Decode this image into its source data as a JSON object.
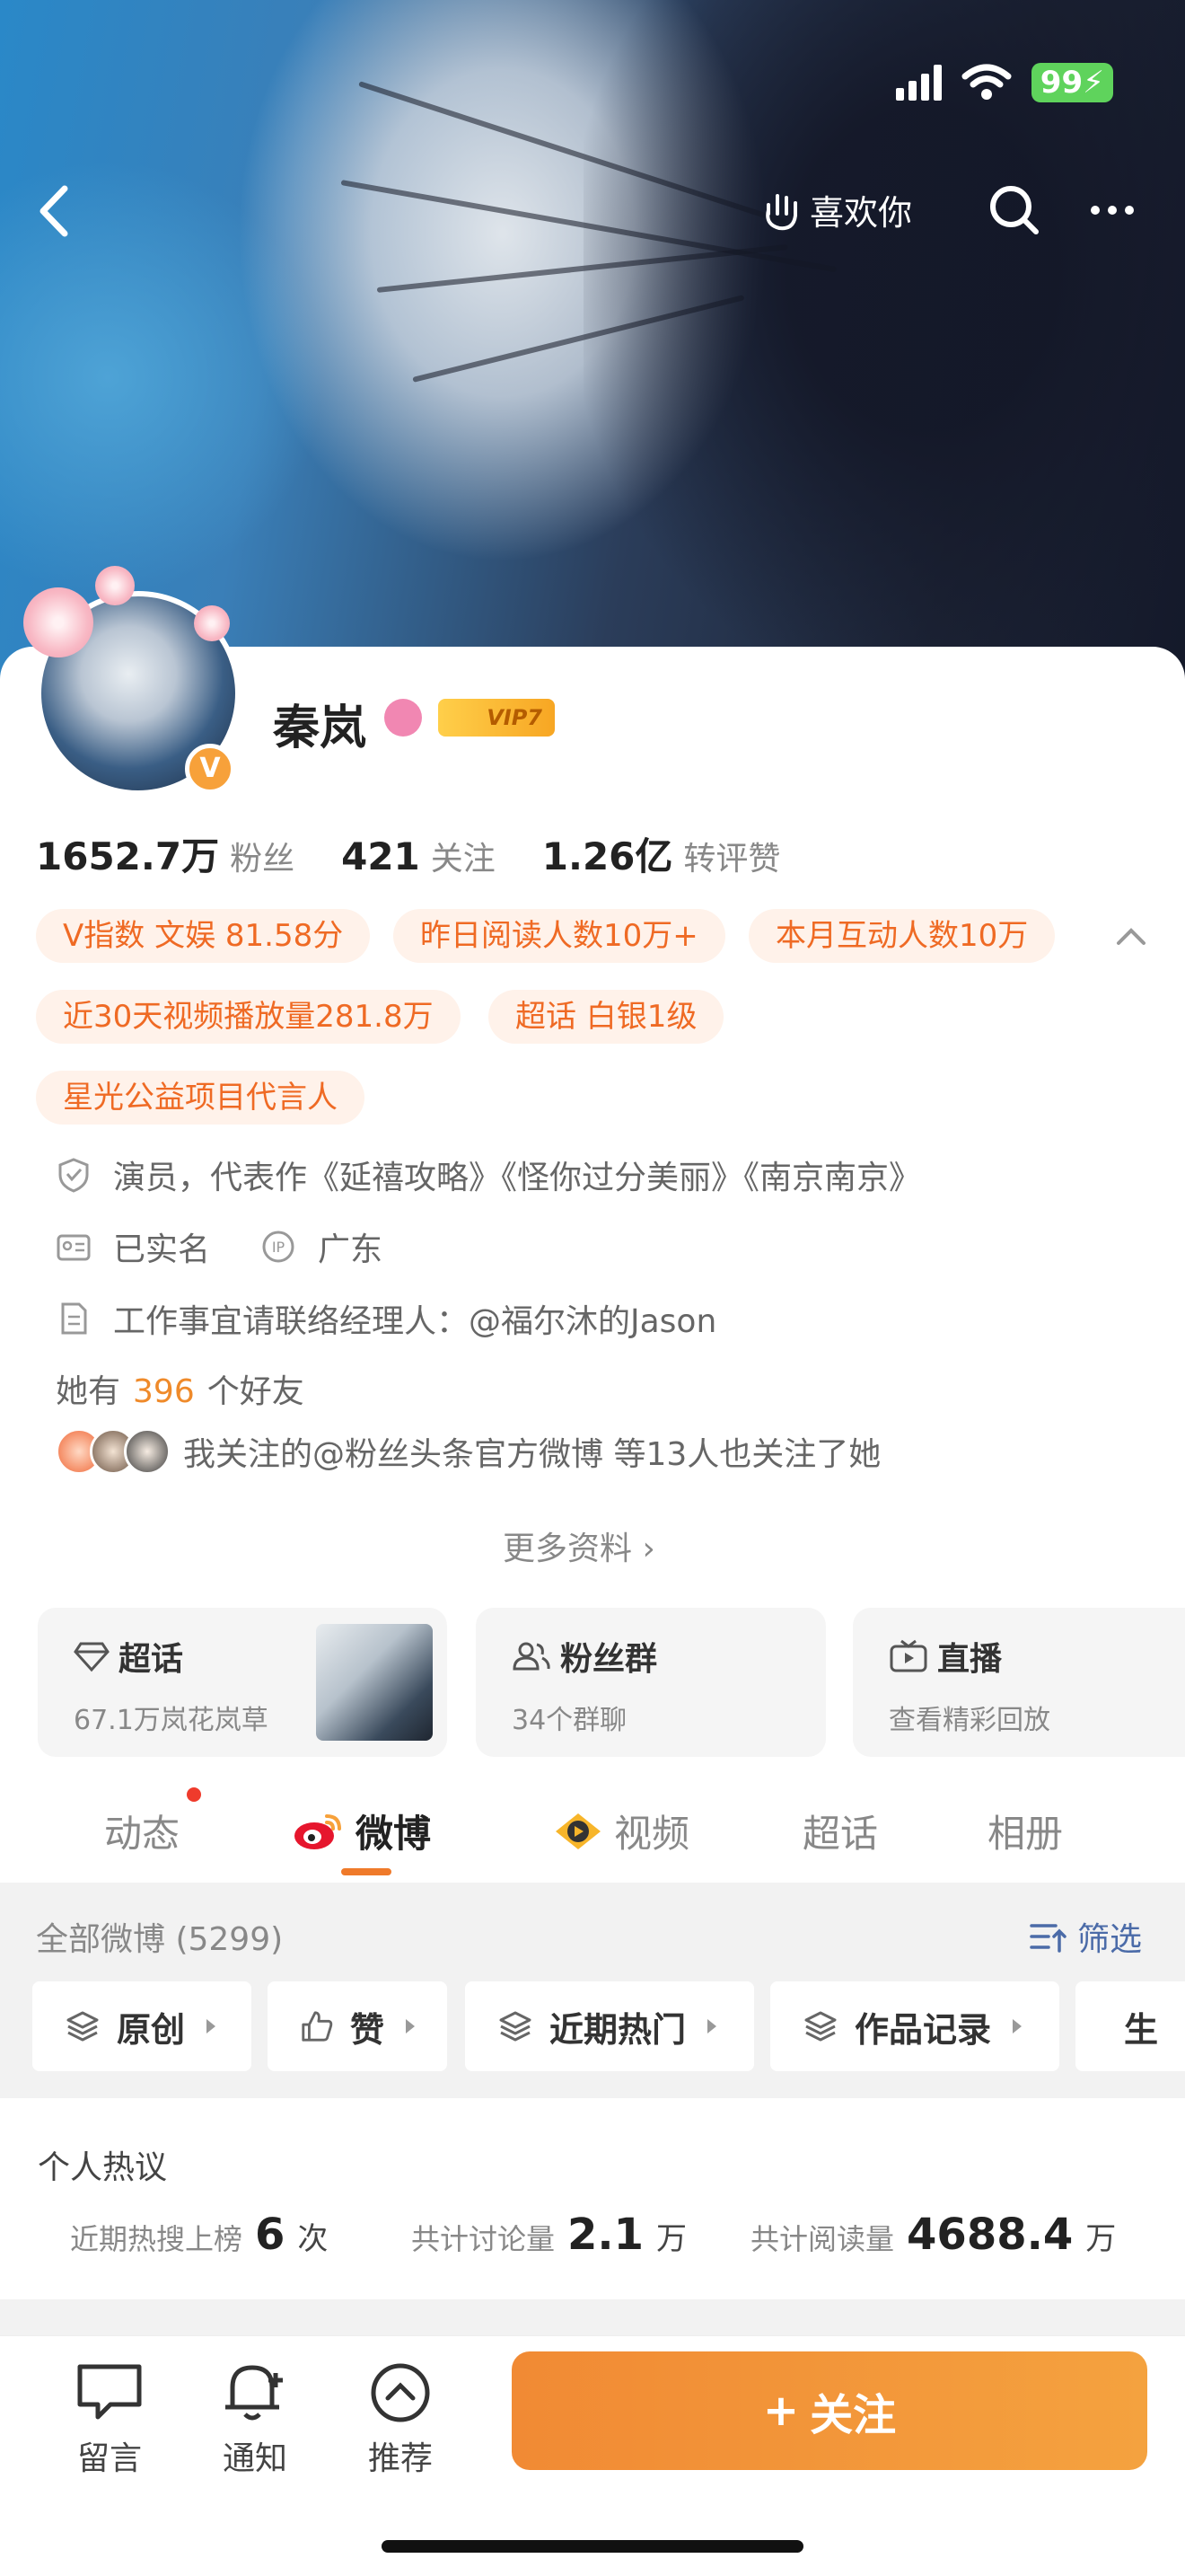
{
  "status_bar": {
    "battery": "99"
  },
  "topbar": {
    "like_label": "喜欢你"
  },
  "profile": {
    "name": "秦岚",
    "vip_badge": "VIP7",
    "stats": [
      {
        "value": "1652.7万",
        "label": "粉丝"
      },
      {
        "value": "421",
        "label": "关注"
      },
      {
        "value": "1.26亿",
        "label": "转评赞"
      }
    ],
    "tags": [
      "V指数 文娱 81.58分",
      "昨日阅读人数10万+",
      "本月互动人数10万",
      "近30天视频播放量281.8万",
      "超话 白银1级",
      "星光公益项目代言人"
    ],
    "info": {
      "verification": "演员，代表作《延禧攻略》《怪你过分美丽》《南京南京》",
      "real_name": "已实名",
      "ip_location": "广东",
      "contact": "工作事宜请联络经理人：@福尔沐的Jason"
    },
    "friends": {
      "prefix": "她有",
      "count": "396",
      "suffix": "个好友"
    },
    "mutual_follow": "我关注的@粉丝头条官方微博 等13人也关注了她",
    "more_info": "更多资料 ›"
  },
  "features": [
    {
      "title": "超话",
      "sub": "67.1万岚花岚草"
    },
    {
      "title": "粉丝群",
      "sub": "34个群聊"
    },
    {
      "title": "直播",
      "sub": "查看精彩回放"
    }
  ],
  "tabs": [
    "动态",
    "微博",
    "视频",
    "超话",
    "相册"
  ],
  "feed": {
    "count_label": "全部微博 (5299)",
    "filter_label": "筛选",
    "chips": [
      "原创",
      "赞",
      "近期热门",
      "作品记录",
      "生"
    ]
  },
  "hot": {
    "title": "个人热议",
    "items": [
      {
        "label": "近期热搜上榜",
        "value": "6",
        "unit": "次"
      },
      {
        "label": "共计讨论量",
        "value": "2.1",
        "unit": "万"
      },
      {
        "label": "共计阅读量",
        "value": "4688.4",
        "unit": "万"
      }
    ]
  },
  "bottom_bar": {
    "comment": "留言",
    "notify": "通知",
    "recommend": "推荐",
    "follow": "关注"
  },
  "colors": {
    "accent": "#ef6a24",
    "tag_bg": "#fff2ea",
    "link": "#4b6ba8"
  }
}
